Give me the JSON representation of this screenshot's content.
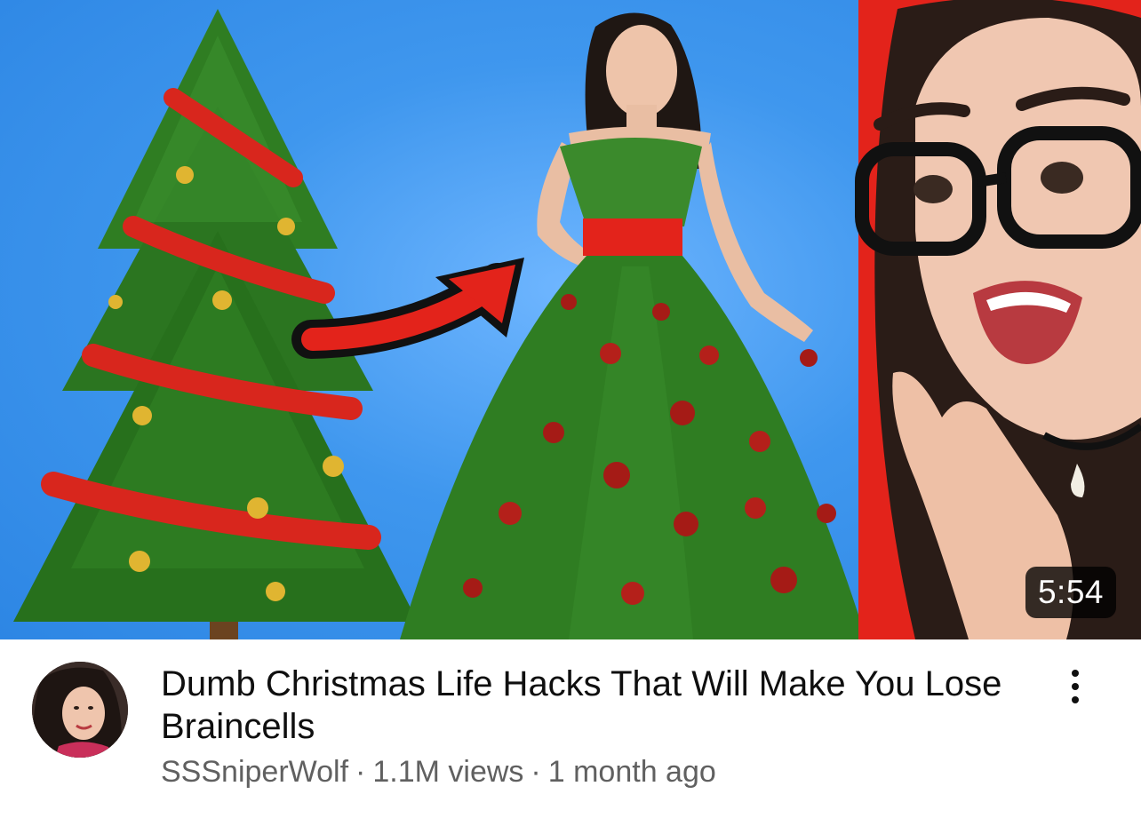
{
  "video": {
    "duration": "5:54",
    "title": "Dumb Christmas Life Hacks That Will Make You Lose Braincells",
    "channel": "SSSniperWolf",
    "separator": "·",
    "views": "1.1M views",
    "age": "1 month ago"
  },
  "icons": {
    "more": "vertical-ellipsis-icon"
  },
  "colors": {
    "thumbnail_background": "#3f97ee",
    "accent_red": "#e3231b",
    "title_text": "#0f0f0f",
    "secondary_text": "#606060",
    "duration_badge": "#000000"
  }
}
